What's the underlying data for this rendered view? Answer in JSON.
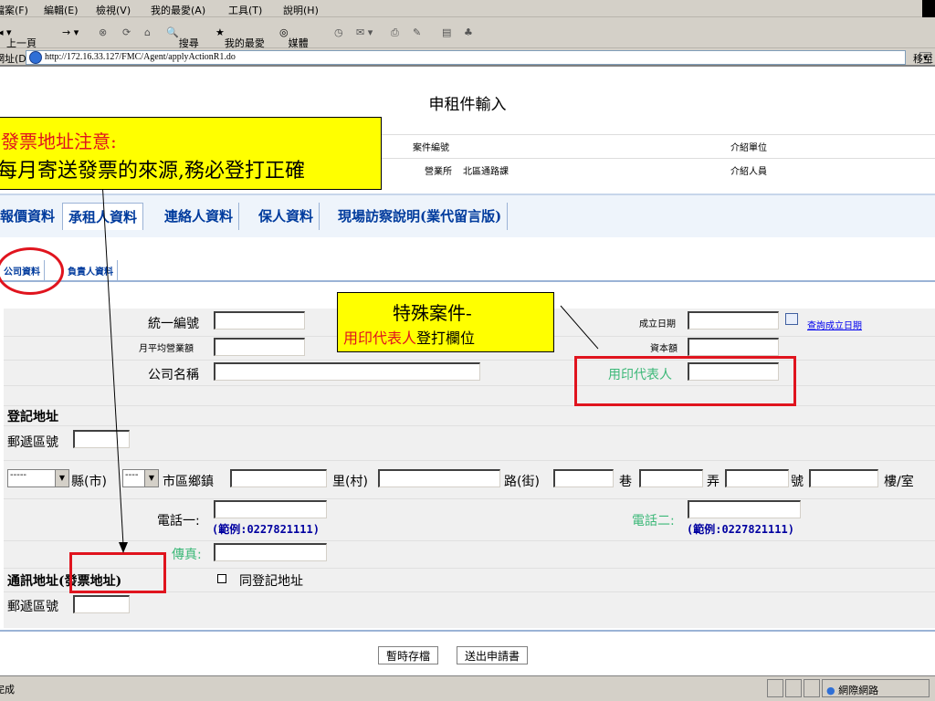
{
  "menu": [
    "檔案(F)",
    "編輯(E)",
    "檢視(V)",
    "我的最愛(A)",
    "工具(T)",
    "說明(H)"
  ],
  "toolbar": {
    "back": "上一頁",
    "search": "搜尋",
    "favorites": "我的最愛",
    "media": "媒體"
  },
  "address": {
    "label": "網址(D)",
    "url": "http://172.16.33.127/FMC/Agent/applyActionR1.do",
    "go": "移至"
  },
  "page": {
    "title": "申租件輸入"
  },
  "header_rows": {
    "case_no": "案件編號",
    "referral_unit": "介紹單位",
    "office_label": "營業所",
    "office_value": "北區通路課",
    "referrer": "介紹人員"
  },
  "tabs": [
    "報價資料",
    "承租人資料",
    "連絡人資料",
    "保人資料",
    "現場訪察說明(業代留言版)"
  ],
  "subtabs": [
    "公司資料",
    "負責人資料"
  ],
  "form": {
    "tax_id": "統一編號",
    "monthly_revenue": "月平均營業額",
    "company_name": "公司名稱",
    "established_date": "成立日期",
    "query_date_link": "查詢成立日期",
    "capital": "資本額",
    "seal_rep": "用印代表人",
    "reg_addr_title": "登記地址",
    "zip": "郵遞區號",
    "county_select": "-----",
    "city_select": "----",
    "county": "縣(市)",
    "district": "市區鄉鎮",
    "village": "里(村)",
    "road": "路(街)",
    "lane": "巷",
    "alley": "弄",
    "number": "號",
    "floor": "樓/室",
    "phone1": "電話一:",
    "phone2": "電話二:",
    "phone_example": "(範例:0227821111)",
    "fax": "傳真:",
    "mail_addr_title": "通訊地址(發票地址)",
    "same_as_reg": "同登記地址",
    "zip2": "郵遞區號"
  },
  "buttons": {
    "save": "暫時存檔",
    "submit": "送出申請書"
  },
  "status": {
    "left": "完成",
    "zone": "網際網路"
  },
  "annotations": {
    "invoice_title": "發票地址注意:",
    "invoice_body": "每月寄送發票的來源,務必登打正確",
    "special_title": "特殊案件-",
    "special_red": "用印代表人",
    "special_rest": "登打欄位"
  }
}
